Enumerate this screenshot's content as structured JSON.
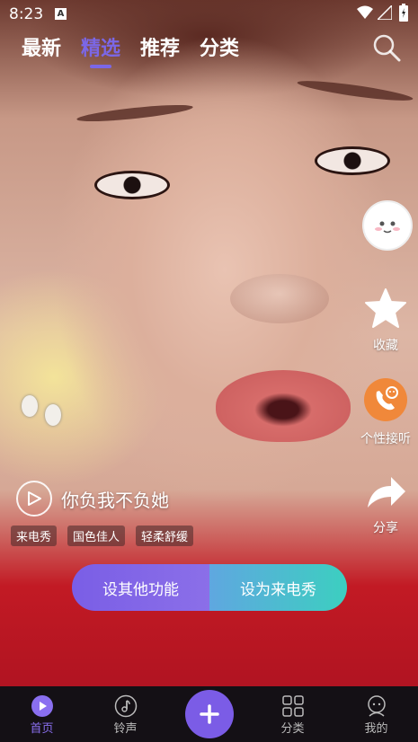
{
  "status_bar": {
    "time": "8:23",
    "notification": "A"
  },
  "tabs": [
    {
      "label": "最新"
    },
    {
      "label": "精选"
    },
    {
      "label": "推荐"
    },
    {
      "label": "分类"
    }
  ],
  "active_tab": "精选",
  "video": {
    "title": "你负我不负她",
    "tags": [
      "来电秀",
      "国色佳人",
      "轻柔舒缓"
    ]
  },
  "actions": {
    "favorite_label": "收藏",
    "custom_answer_label": "个性接听",
    "share_label": "分享"
  },
  "buttons": {
    "other_label": "设其他功能",
    "set_call_label": "设为来电秀"
  },
  "nav": {
    "home": "首页",
    "ringtone": "铃声",
    "category": "分类",
    "mine": "我的"
  },
  "colors": {
    "accent": "#7b67e6",
    "teal": "#3ccfc0",
    "nav_bg": "#141015"
  }
}
